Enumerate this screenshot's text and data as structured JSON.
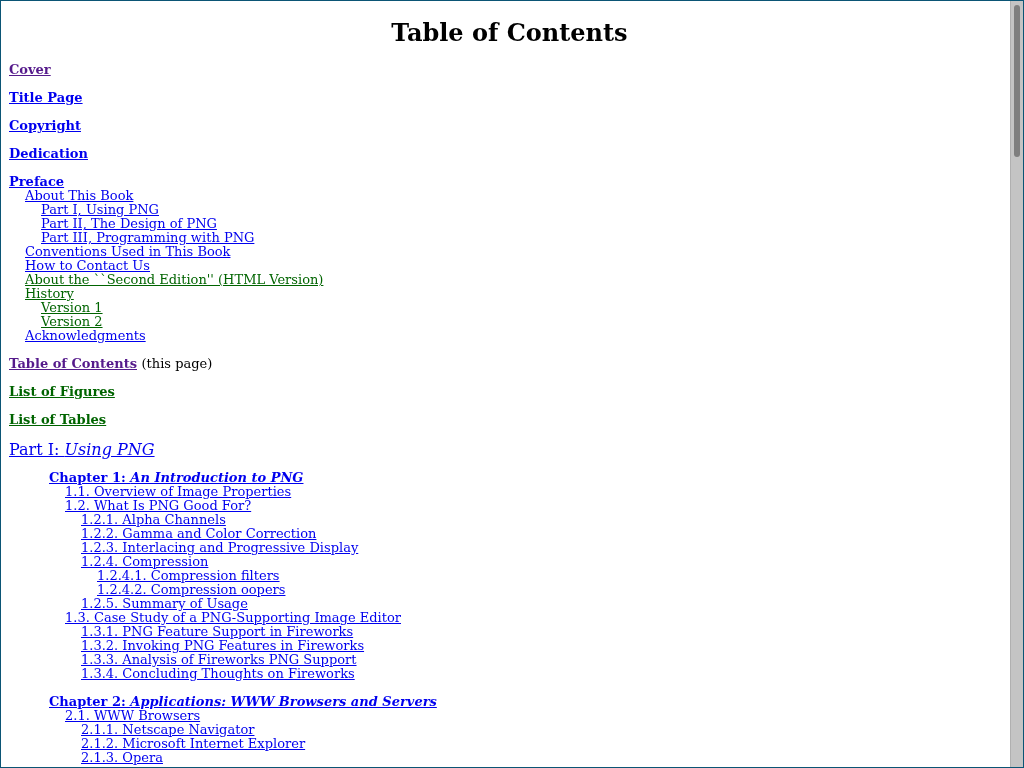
{
  "title": "Table of Contents",
  "entries": [
    {
      "kind": "front",
      "label": "Cover",
      "color": "#551a8b"
    },
    {
      "kind": "front",
      "label": "Title Page",
      "color": "#0000ee"
    },
    {
      "kind": "front",
      "label": "Copyright",
      "color": "#0000ee"
    },
    {
      "kind": "front",
      "label": "Dedication",
      "color": "#0000ee"
    },
    {
      "kind": "front",
      "label": "Preface",
      "color": "#0000ee",
      "children": [
        {
          "label": "About This Book",
          "color": "#0000ee",
          "children": [
            {
              "label": "Part I, Using PNG",
              "color": "#0000ee"
            },
            {
              "label": "Part II, The Design of PNG",
              "color": "#0000ee"
            },
            {
              "label": "Part III, Programming with PNG",
              "color": "#0000ee"
            }
          ]
        },
        {
          "label": "Conventions Used in This Book",
          "color": "#0000ee"
        },
        {
          "label": "How to Contact Us",
          "color": "#0000ee"
        },
        {
          "label": "About the ``Second Edition'' (HTML Version)",
          "color": "#006400"
        },
        {
          "label": "History",
          "color": "#006400",
          "children": [
            {
              "label": "Version 1",
              "color": "#006400"
            },
            {
              "label": "Version 2",
              "color": "#006400"
            }
          ]
        },
        {
          "label": "Acknowledgments",
          "color": "#0000ee"
        }
      ]
    },
    {
      "kind": "front",
      "label": "Table of Contents",
      "color": "#551a8b",
      "note": "(this page)"
    },
    {
      "kind": "front",
      "label": "List of Figures",
      "color": "#006400"
    },
    {
      "kind": "front",
      "label": "List of Tables",
      "color": "#006400"
    },
    {
      "kind": "part",
      "label": "Part I: *Using PNG*",
      "color": "#0000ee"
    },
    {
      "kind": "chapter",
      "label": "Chapter 1: *An Introduction to PNG*",
      "color": "#0000ee",
      "children": [
        {
          "label": "1.1. Overview of Image Properties",
          "color": "#0000ee"
        },
        {
          "label": "1.2. What Is PNG Good For?",
          "color": "#0000ee",
          "children": [
            {
              "label": "1.2.1. Alpha Channels",
              "color": "#0000ee"
            },
            {
              "label": "1.2.2. Gamma and Color Correction",
              "color": "#0000ee"
            },
            {
              "label": "1.2.3. Interlacing and Progressive Display",
              "color": "#0000ee"
            },
            {
              "label": "1.2.4. Compression",
              "color": "#0000ee",
              "children": [
                {
                  "label": "1.2.4.1. Compression filters",
                  "color": "#0000ee"
                },
                {
                  "label": "1.2.4.2. Compression oopers",
                  "color": "#0000ee"
                }
              ]
            },
            {
              "label": "1.2.5. Summary of Usage",
              "color": "#0000ee"
            }
          ]
        },
        {
          "label": "1.3. Case Study of a PNG-Supporting Image Editor",
          "color": "#0000ee",
          "children": [
            {
              "label": "1.3.1. PNG Feature Support in Fireworks",
              "color": "#0000ee"
            },
            {
              "label": "1.3.2. Invoking PNG Features in Fireworks",
              "color": "#0000ee"
            },
            {
              "label": "1.3.3. Analysis of Fireworks PNG Support",
              "color": "#0000ee"
            },
            {
              "label": "1.3.4. Concluding Thoughts on Fireworks",
              "color": "#0000ee"
            }
          ]
        }
      ]
    },
    {
      "kind": "chapter",
      "label": "Chapter 2: *Applications: WWW Browsers and Servers*",
      "color": "#0000ee",
      "children": [
        {
          "label": "2.1. WWW Browsers",
          "color": "#0000ee",
          "children": [
            {
              "label": "2.1.1. Netscape Navigator",
              "color": "#0000ee"
            },
            {
              "label": "2.1.2. Microsoft Internet Explorer",
              "color": "#0000ee"
            },
            {
              "label": "2.1.3. Opera",
              "color": "#0000ee"
            }
          ]
        }
      ]
    }
  ]
}
